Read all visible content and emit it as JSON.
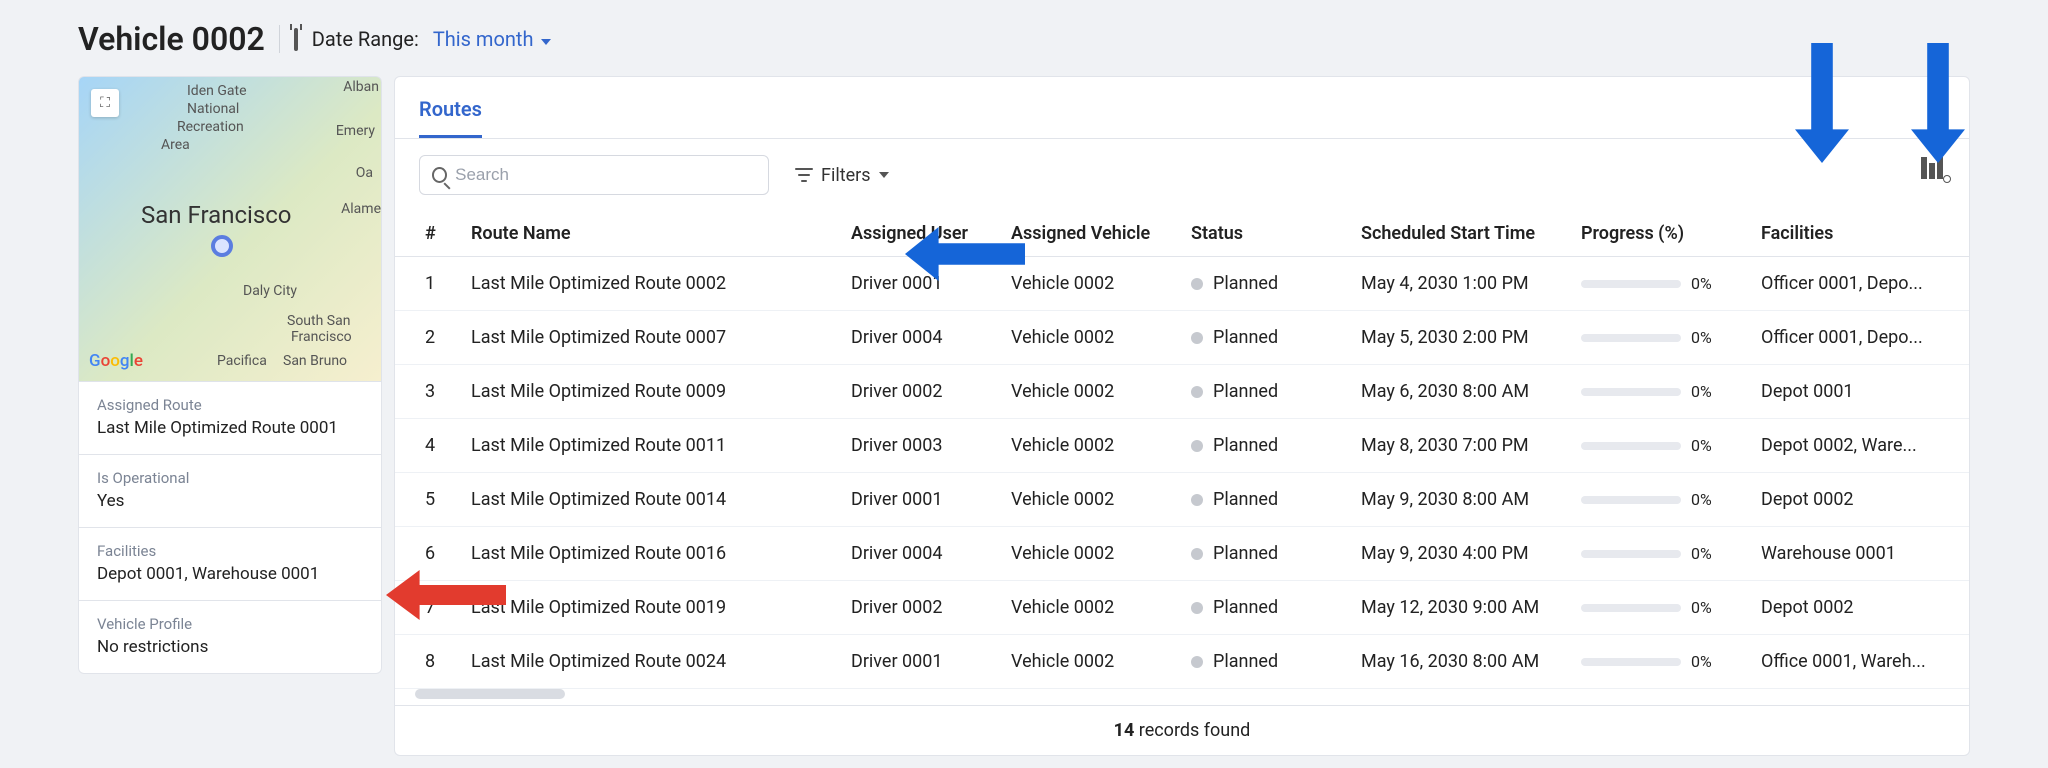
{
  "header": {
    "title": "Vehicle 0002",
    "date_range_label": "Date Range:",
    "date_range_value": "This month"
  },
  "map": {
    "city": "San Francisco",
    "labels": [
      "Iden Gate",
      "National",
      "Recreation",
      "Area",
      "Emery",
      "Alban",
      "Alame",
      "Oa",
      "Daly City",
      "South San",
      "Francisco",
      "Pacifica",
      "San Bruno"
    ]
  },
  "sidebar": {
    "assigned_route": {
      "label": "Assigned Route",
      "value": "Last Mile Optimized Route 0001"
    },
    "is_operational": {
      "label": "Is Operational",
      "value": "Yes"
    },
    "facilities": {
      "label": "Facilities",
      "value": "Depot 0001, Warehouse 0001"
    },
    "vehicle_profile": {
      "label": "Vehicle Profile",
      "value": "No restrictions"
    }
  },
  "tabs": {
    "active": "Routes"
  },
  "toolbar": {
    "search_placeholder": "Search",
    "filters_label": "Filters"
  },
  "columns": [
    "#",
    "Route Name",
    "Assigned User",
    "Assigned Vehicle",
    "Status",
    "Scheduled Start Time",
    "Progress (%)",
    "Facilities"
  ],
  "rows": [
    {
      "n": "1",
      "route": "Last Mile Optimized Route 0002",
      "user": "Driver 0001",
      "vehicle": "Vehicle 0002",
      "status": "Planned",
      "time": "May 4, 2030 1:00 PM",
      "progress": "0%",
      "facilities": "Officer 0001, Depo..."
    },
    {
      "n": "2",
      "route": "Last Mile Optimized Route 0007",
      "user": "Driver 0004",
      "vehicle": "Vehicle 0002",
      "status": "Planned",
      "time": "May 5, 2030 2:00 PM",
      "progress": "0%",
      "facilities": "Officer 0001, Depo..."
    },
    {
      "n": "3",
      "route": "Last Mile Optimized Route 0009",
      "user": "Driver 0002",
      "vehicle": "Vehicle 0002",
      "status": "Planned",
      "time": "May 6, 2030 8:00 AM",
      "progress": "0%",
      "facilities": "Depot 0001"
    },
    {
      "n": "4",
      "route": "Last Mile Optimized Route 0011",
      "user": "Driver 0003",
      "vehicle": "Vehicle 0002",
      "status": "Planned",
      "time": "May 8, 2030 7:00 PM",
      "progress": "0%",
      "facilities": "Depot 0002, Ware..."
    },
    {
      "n": "5",
      "route": "Last Mile Optimized Route 0014",
      "user": "Driver 0001",
      "vehicle": "Vehicle 0002",
      "status": "Planned",
      "time": "May 9, 2030 8:00 AM",
      "progress": "0%",
      "facilities": "Depot 0002"
    },
    {
      "n": "6",
      "route": "Last Mile Optimized Route 0016",
      "user": "Driver 0004",
      "vehicle": "Vehicle 0002",
      "status": "Planned",
      "time": "May 9, 2030 4:00 PM",
      "progress": "0%",
      "facilities": "Warehouse 0001"
    },
    {
      "n": "7",
      "route": "Last Mile Optimized Route 0019",
      "user": "Driver 0002",
      "vehicle": "Vehicle 0002",
      "status": "Planned",
      "time": "May 12, 2030 9:00 AM",
      "progress": "0%",
      "facilities": "Depot 0002"
    },
    {
      "n": "8",
      "route": "Last Mile Optimized Route 0024",
      "user": "Driver 0001",
      "vehicle": "Vehicle 0002",
      "status": "Planned",
      "time": "May 16, 2030 8:00 AM",
      "progress": "0%",
      "facilities": "Office 0001, Wareh..."
    }
  ],
  "footer": {
    "count": "14",
    "suffix": " records found"
  }
}
